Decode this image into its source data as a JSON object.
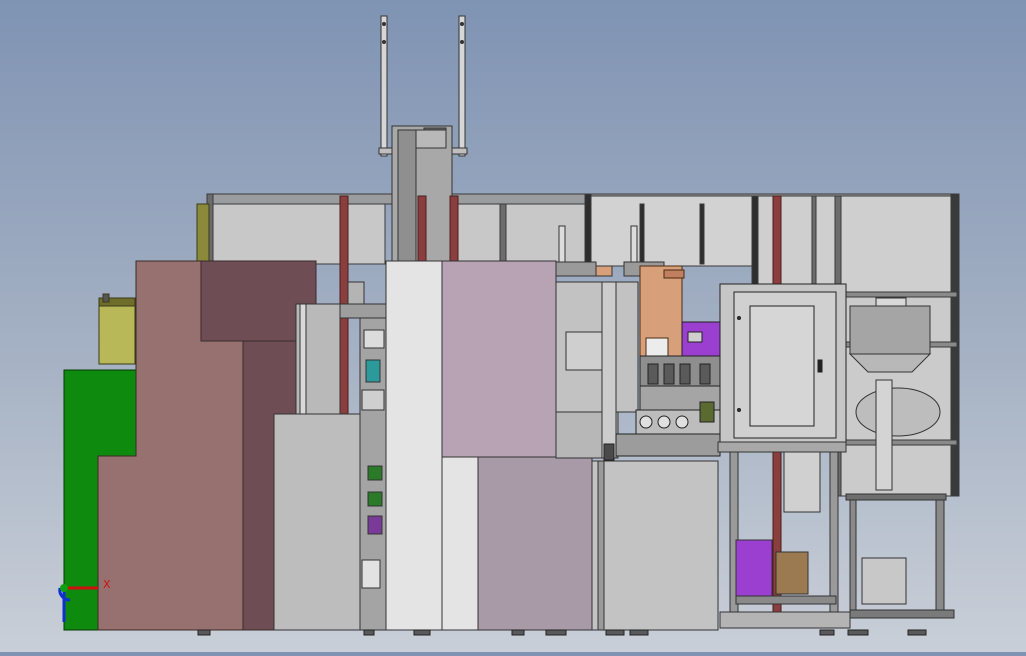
{
  "viewport": {
    "background_top": "#7f93b3",
    "background_bottom": "#c9cfd8"
  },
  "triad": {
    "x_label": "X",
    "x_color": "#d01010",
    "y_color": "#10a010",
    "z_color": "#1030d0"
  },
  "colors": {
    "frame_gray": "#8d8f91",
    "panel_gray": "#c3c3c3",
    "green_cabinet": "#0e8a0e",
    "brown_cabinet": "#977070",
    "dark_brown": "#6e4d55",
    "mauve_cabinet": "#b7a3b3",
    "light_panel": "#e4e4e4",
    "copper_plate": "#d8a07a",
    "purple_parts": "#9a3fd0",
    "olive_part": "#8a8a3a",
    "rust_post": "#8a3e3e"
  }
}
